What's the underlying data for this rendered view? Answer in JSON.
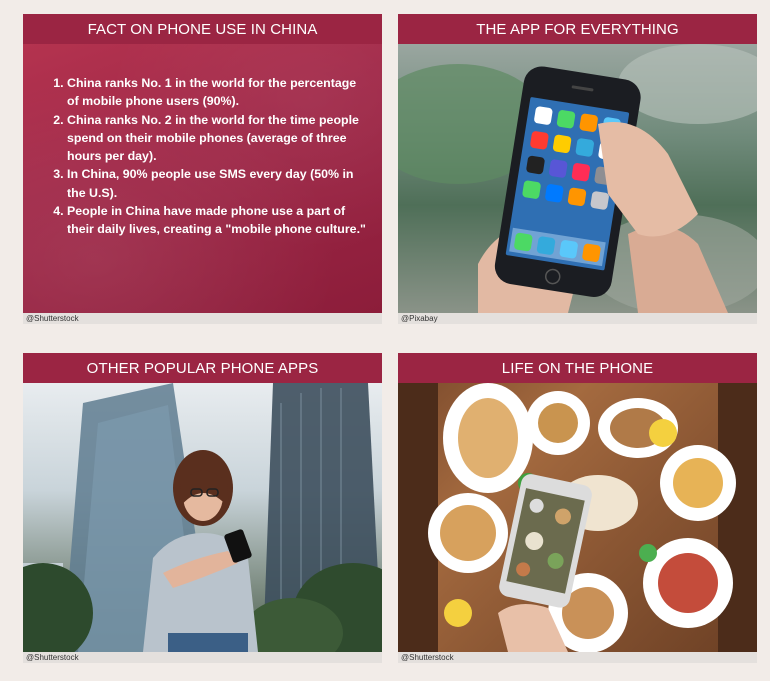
{
  "cards": [
    {
      "title": "FACT ON PHONE USE IN CHINA",
      "credit": "@Shutterstock",
      "facts": [
        "China ranks No. 1 in the world for the percentage of mobile phone users (90%).",
        "China ranks No. 2 in the world for the time people spend on their mobile phones (average of three hours per day).",
        "In China, 90% people use SMS every day (50% in the U.S).",
        "People in China have made phone use a part of their daily lives, creating a \"mobile phone culture.\""
      ]
    },
    {
      "title": "THE APP FOR EVERYTHING",
      "credit": "@Pixabay",
      "image": "hand-holding-smartphone-photo"
    },
    {
      "title": "OTHER POPULAR PHONE APPS",
      "credit": "@Shutterstock",
      "image": "woman-using-phone-city-photo"
    },
    {
      "title": "LIFE ON THE PHONE",
      "credit": "@Shutterstock",
      "image": "phone-photographing-food-photo"
    }
  ],
  "colors": {
    "header": "#9b2543",
    "background": "#f2ece8"
  }
}
